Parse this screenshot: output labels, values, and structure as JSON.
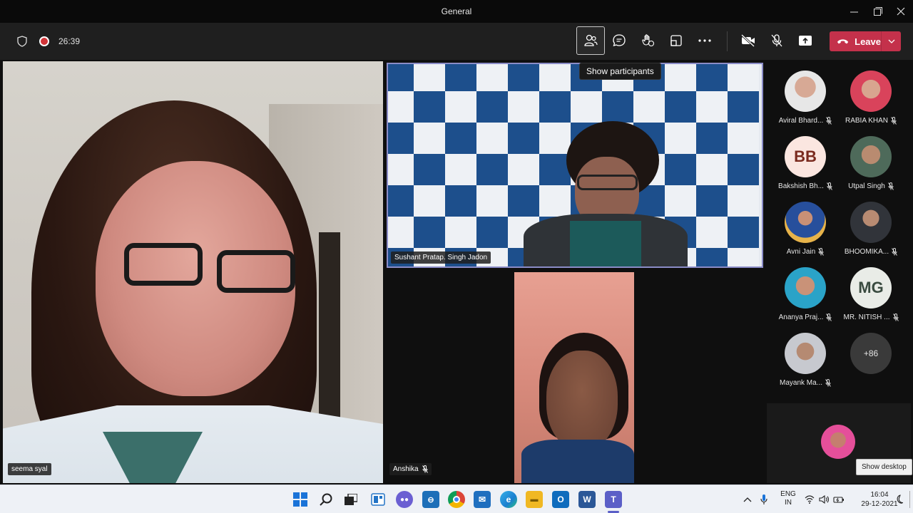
{
  "window": {
    "title": "General"
  },
  "toolbar": {
    "timer": "26:39",
    "leave_label": "Leave",
    "tooltip_participants": "Show participants"
  },
  "videos": {
    "main_left": {
      "name": "seema syal"
    },
    "top_right": {
      "name": "Sushant Pratap. Singh Jadon"
    },
    "bottom": {
      "name": "Anshika"
    }
  },
  "participants": [
    {
      "name": "Aviral Bhard...",
      "type": "photo"
    },
    {
      "name": "RABIA KHAN",
      "type": "photo"
    },
    {
      "name": "Bakshish Bh...",
      "type": "initials",
      "initials": "BB"
    },
    {
      "name": "Utpal Singh",
      "type": "photo"
    },
    {
      "name": "Avni Jain",
      "type": "photo"
    },
    {
      "name": "BHOOMIKA...",
      "type": "photo"
    },
    {
      "name": "Ananya Praj...",
      "type": "photo"
    },
    {
      "name": "MR. NITISH ...",
      "type": "initials",
      "initials": "MG"
    },
    {
      "name": "Mayank Ma...",
      "type": "photo"
    },
    {
      "name": "",
      "type": "more",
      "label": "+86"
    }
  ],
  "taskbar": {
    "lang_top": "ENG",
    "lang_bottom": "IN",
    "time": "16:04",
    "date": "29-12-2021",
    "tooltip_desktop": "Show desktop"
  },
  "colors": {
    "leave": "#c4314b",
    "active_tile_border": "#8b8cc7",
    "record": "#d13438",
    "teams_purple": "#5b5fc7"
  }
}
